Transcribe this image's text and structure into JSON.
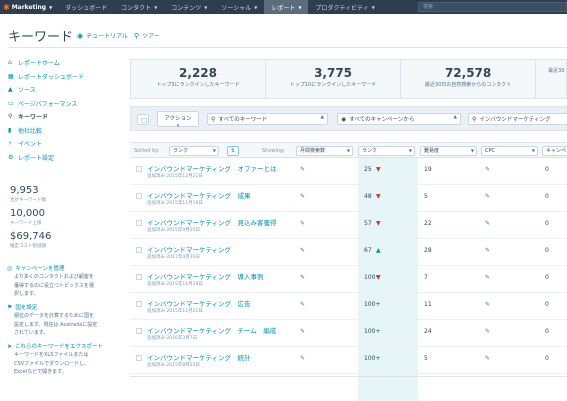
{
  "topnav": {
    "brand": "Marketing",
    "items": [
      "ダッシュボード",
      "コンタクト",
      "コンテンツ",
      "ソーシャル",
      "レポート",
      "プロダクティビティ"
    ],
    "search_placeholder": "検索"
  },
  "header": {
    "title": "キーワード",
    "tutorial": "チュートリアル",
    "tour": "ツアー"
  },
  "sidebar": {
    "items": [
      {
        "label": "レポートホーム",
        "icon": "home-icon"
      },
      {
        "label": "レポートダッシュボード",
        "icon": "dashboard-icon"
      },
      {
        "label": "ソース",
        "icon": "chart-icon"
      },
      {
        "label": "ページパフォーマンス",
        "icon": "page-icon"
      },
      {
        "label": "キーワード",
        "icon": "key-icon"
      },
      {
        "label": "他社比較",
        "icon": "bar-chart-icon"
      },
      {
        "label": "イベント",
        "icon": "lightning-icon"
      },
      {
        "label": "レポート設定",
        "icon": "gear-icon"
      }
    ],
    "stats": [
      {
        "value": "9,953",
        "label": "合計キーワード数"
      },
      {
        "value": "10,000",
        "label": "キーワード上限"
      },
      {
        "value": "$69,746",
        "label": "推定コスト削減額"
      }
    ],
    "tips": [
      {
        "title": "キャンペーンを管理",
        "body": [
          "より多くのコンタクトおよび顧客を",
          "獲得するのに役立つトピックスを選",
          "択します。"
        ]
      },
      {
        "title": "国を設定",
        "body": [
          "順位のデータを計算するために国を",
          "設定します。現在は Australiaに設定",
          "されています。"
        ]
      },
      {
        "title": "これらのキーワードをエクスポート",
        "body": [
          "キーワードをXLSファイルまたは",
          "CSVファイルでダウンロードし、",
          "Excelなどで開きます。"
        ]
      }
    ]
  },
  "summary": [
    {
      "value": "2,228",
      "label": "トップ3にランクインしたキーワード"
    },
    {
      "value": "3,775",
      "label": "トップ10にランクインしたキーワード"
    },
    {
      "value": "72,578",
      "label": "最近30日の自然検索からのコンタクト"
    },
    {
      "value": "",
      "label": "最近30"
    }
  ],
  "filters": {
    "action": "アクション",
    "keyword_filter": "すべてのキーワード",
    "campaign_filter": "すべてのキャンペーンから",
    "search_value": "インバウンドマーケティング"
  },
  "table": {
    "sorted_by_label": "Sorted by:",
    "sorted_by_value": "ランク",
    "showing_label": "Showing:",
    "columns": [
      "月間検索数",
      "ランク",
      "難易度",
      "CPC",
      "キャンペ"
    ],
    "rows": [
      {
        "keyword": "インバウンドマーケティング　オファーとは",
        "added": "追加済み 2015年12月21日",
        "monthly": "",
        "rank": "25",
        "trend": "down",
        "difficulty": "19",
        "cpc": "",
        "campaigns": "0"
      },
      {
        "keyword": "インバウンドマーケティング　成果",
        "added": "追加済み 2015年11月19日",
        "monthly": "",
        "rank": "48",
        "trend": "down",
        "difficulty": "5",
        "cpc": "",
        "campaigns": "0"
      },
      {
        "keyword": "インバウンドマーケティング　見込み客獲得",
        "added": "追加済み 2015年9月25日",
        "monthly": "",
        "rank": "57",
        "trend": "down",
        "difficulty": "22",
        "cpc": "",
        "campaigns": "0"
      },
      {
        "keyword": "インバウンドマーケティング",
        "added": "追加済み 2017年4月10日",
        "monthly": "",
        "rank": "67",
        "trend": "up",
        "difficulty": "28",
        "cpc": "",
        "campaigns": "0"
      },
      {
        "keyword": "インバウンドマーケティング　導入事例",
        "added": "追加済み 2015年11月19日",
        "monthly": "",
        "rank": "100+",
        "trend": "down",
        "difficulty": "7",
        "cpc": "",
        "campaigns": "0"
      },
      {
        "keyword": "インバウンドマーケティング　広告",
        "added": "追加済み 2015年11月21日",
        "monthly": "",
        "rank": "100+",
        "trend": "",
        "difficulty": "11",
        "cpc": "",
        "campaigns": "0"
      },
      {
        "keyword": "インバウンドマーケティング　チーム　編成",
        "added": "追加済み 2016年3月7日",
        "monthly": "",
        "rank": "100+",
        "trend": "",
        "difficulty": "24",
        "cpc": "",
        "campaigns": "0"
      },
      {
        "keyword": "インバウンドマーケティング　統計",
        "added": "追加済み 2015年9月25日",
        "monthly": "",
        "rank": "100+",
        "trend": "",
        "difficulty": "5",
        "cpc": "",
        "campaigns": "0"
      }
    ]
  }
}
